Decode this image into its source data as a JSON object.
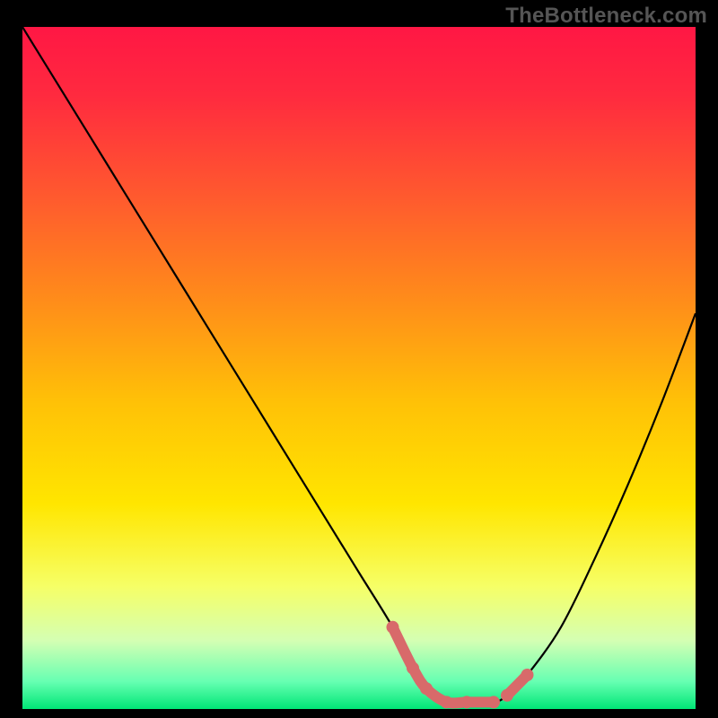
{
  "attribution": "TheBottleneck.com",
  "chart_data": {
    "type": "line",
    "title": "",
    "xlabel": "",
    "ylabel": "",
    "xlim": [
      0,
      100
    ],
    "ylim": [
      0,
      100
    ],
    "series": [
      {
        "name": "curve",
        "x": [
          0,
          5,
          10,
          15,
          20,
          25,
          30,
          35,
          40,
          45,
          50,
          55,
          58,
          60,
          63,
          66,
          70,
          72,
          75,
          80,
          85,
          90,
          95,
          100
        ],
        "values": [
          100,
          92,
          84,
          76,
          68,
          60,
          52,
          44,
          36,
          28,
          20,
          12,
          6,
          3,
          1,
          1,
          1,
          2,
          5,
          12,
          22,
          33,
          45,
          58
        ]
      },
      {
        "name": "highlight-left",
        "x": [
          55,
          58,
          60,
          63,
          66,
          70
        ],
        "values": [
          12,
          6,
          3,
          1,
          1,
          1
        ]
      },
      {
        "name": "highlight-right",
        "x": [
          72,
          75
        ],
        "values": [
          2,
          5
        ]
      }
    ],
    "colors": {
      "curve": "#000000",
      "highlight": "#d86a6a",
      "gradient_stops": [
        {
          "offset": 0.0,
          "color": "#ff1744"
        },
        {
          "offset": 0.1,
          "color": "#ff2a3f"
        },
        {
          "offset": 0.25,
          "color": "#ff5a2e"
        },
        {
          "offset": 0.4,
          "color": "#ff8c1a"
        },
        {
          "offset": 0.55,
          "color": "#ffc107"
        },
        {
          "offset": 0.7,
          "color": "#ffe600"
        },
        {
          "offset": 0.82,
          "color": "#f6ff66"
        },
        {
          "offset": 0.9,
          "color": "#d4ffb3"
        },
        {
          "offset": 0.96,
          "color": "#66ffb2"
        },
        {
          "offset": 1.0,
          "color": "#00e676"
        }
      ]
    }
  }
}
